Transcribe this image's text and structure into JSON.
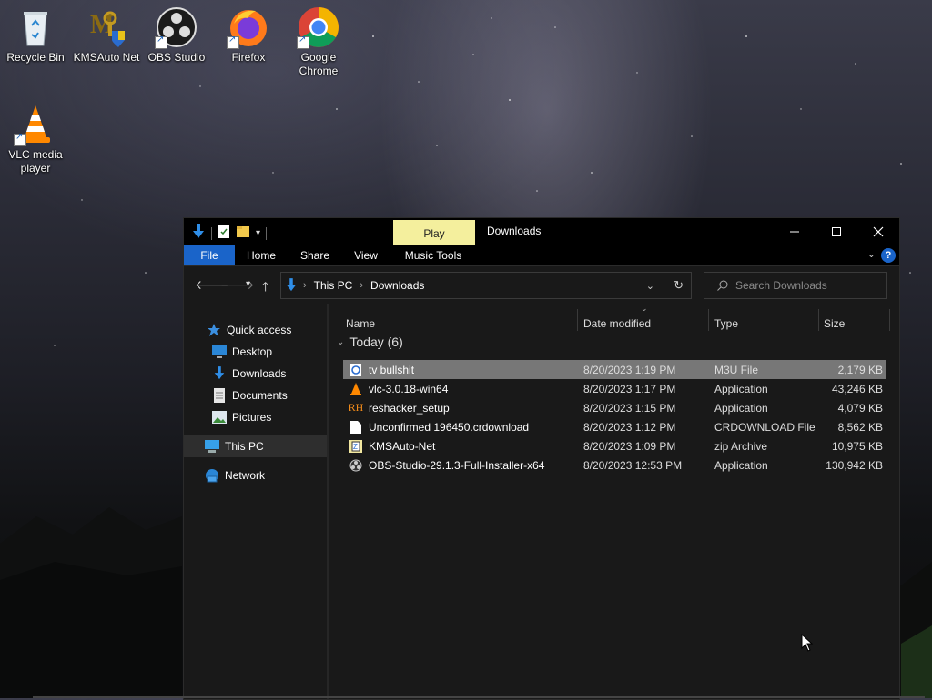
{
  "desktop": {
    "icons": [
      {
        "label": "Recycle Bin",
        "icon": "recycle-bin-icon"
      },
      {
        "label": "KMSAuto Net",
        "icon": "kmsauto-icon"
      },
      {
        "label": "OBS Studio",
        "icon": "obs-icon"
      },
      {
        "label": "Firefox",
        "icon": "firefox-icon"
      },
      {
        "label": "Google Chrome",
        "icon": "chrome-icon"
      },
      {
        "label": "VLC media player",
        "icon": "vlc-icon"
      }
    ]
  },
  "window": {
    "title": "Downloads",
    "context_tab": "Play",
    "ribbon_tabs": [
      "File",
      "Home",
      "Share",
      "View",
      "Music Tools"
    ],
    "help": "?",
    "accent": "#1a64c9",
    "context_color": "#f4ef9d"
  },
  "address": {
    "crumbs": [
      "This PC",
      "Downloads"
    ]
  },
  "search": {
    "placeholder": "Search Downloads"
  },
  "nav_pane": {
    "items": [
      {
        "label": "Quick access",
        "icon": "star-icon"
      },
      {
        "label": "Desktop",
        "icon": "desktop-icon",
        "pinned": true
      },
      {
        "label": "Downloads",
        "icon": "download-icon",
        "pinned": true
      },
      {
        "label": "Documents",
        "icon": "documents-icon",
        "pinned": true
      },
      {
        "label": "Pictures",
        "icon": "pictures-icon",
        "pinned": true
      },
      {
        "label": "This PC",
        "icon": "pc-icon",
        "selected": true
      },
      {
        "label": "Network",
        "icon": "network-icon"
      }
    ]
  },
  "columns": [
    "Name",
    "Date modified",
    "Type",
    "Size"
  ],
  "group": {
    "label": "Today (6)"
  },
  "files": [
    {
      "name": "tv bullshit",
      "date": "8/20/2023 1:19 PM",
      "type": "M3U File",
      "size": "2,179 KB",
      "icon": "m3u-file-icon",
      "selected": true
    },
    {
      "name": "vlc-3.0.18-win64",
      "date": "8/20/2023 1:17 PM",
      "type": "Application",
      "size": "43,246 KB",
      "icon": "vlc-installer-icon"
    },
    {
      "name": "reshacker_setup",
      "date": "8/20/2023 1:15 PM",
      "type": "Application",
      "size": "4,079 KB",
      "icon": "reshacker-icon"
    },
    {
      "name": "Unconfirmed 196450.crdownload",
      "date": "8/20/2023 1:12 PM",
      "type": "CRDOWNLOAD File",
      "size": "8,562 KB",
      "icon": "blank-file-icon"
    },
    {
      "name": "KMSAuto-Net",
      "date": "8/20/2023 1:09 PM",
      "type": "zip Archive",
      "size": "10,975 KB",
      "icon": "zip-file-icon"
    },
    {
      "name": "OBS-Studio-29.1.3-Full-Installer-x64",
      "date": "8/20/2023 12:53 PM",
      "type": "Application",
      "size": "130,942 KB",
      "icon": "obs-installer-icon"
    }
  ]
}
